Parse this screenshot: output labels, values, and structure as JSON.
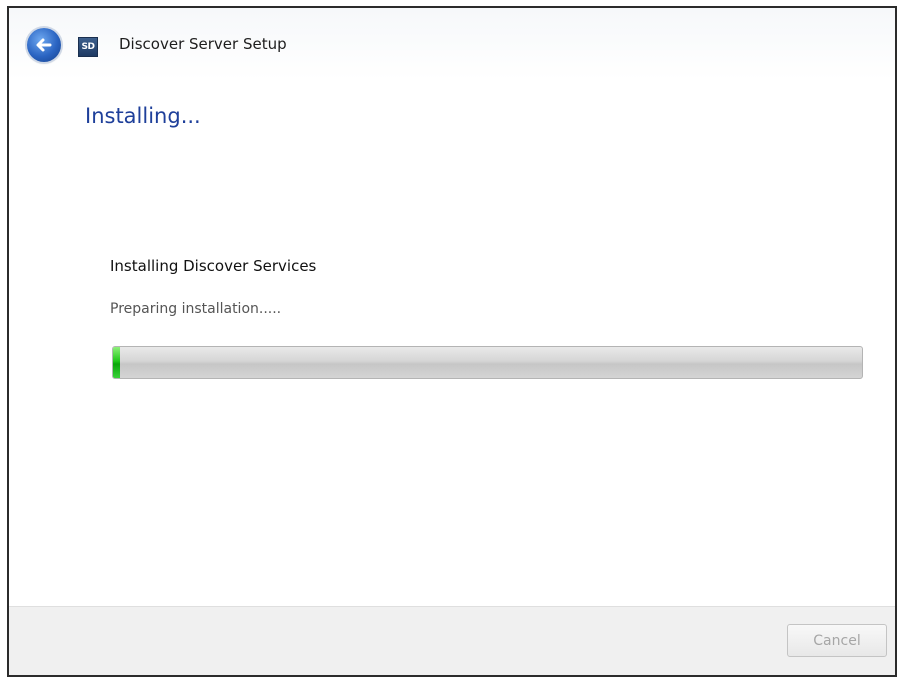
{
  "window": {
    "title": "Discover Server Setup",
    "app_icon_text": "SD"
  },
  "icons": {
    "back": "back-arrow-icon",
    "app": "app-icon"
  },
  "page": {
    "heading": "Installing...",
    "step_title": "Installing Discover Services",
    "status": "Preparing installation....."
  },
  "progress": {
    "fraction": 0.01
  },
  "footer": {
    "cancel_label": "Cancel",
    "cancel_enabled": false
  },
  "colors": {
    "heading": "#1e3f9a",
    "progress_fill": "#22c81c",
    "back_button": "#2a64c2"
  }
}
